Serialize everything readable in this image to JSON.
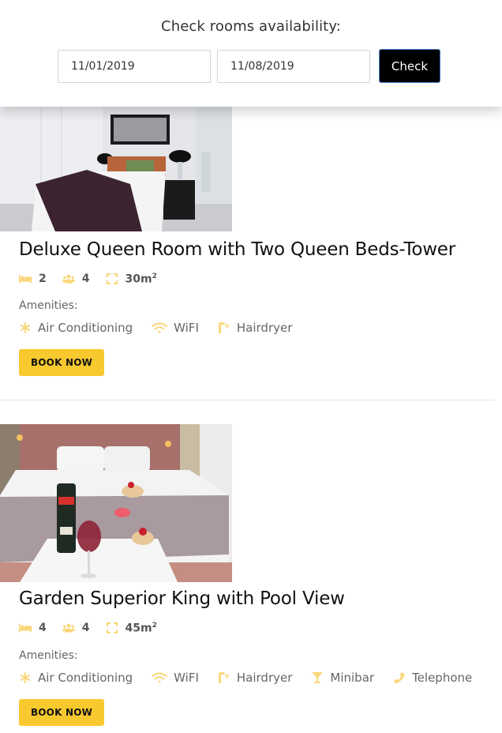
{
  "header": {
    "title": "Check rooms availability:",
    "check_in_value": "11/01/2019",
    "check_out_value": "11/08/2019",
    "check_button_label": "Check"
  },
  "colors": {
    "accent": "#f8c92e",
    "icon": "#f9d77a",
    "check_button_bg": "#000000"
  },
  "rooms": [
    {
      "image": "bedroom-white-interior-photo",
      "title": "Deluxe Queen Room with Two Queen Beds-Tower",
      "beds": "2",
      "guests": "4",
      "size": "30m",
      "size_unit_sup": "2",
      "amenities_label": "Amenities:",
      "amenities": [
        {
          "icon": "snowflake-icon",
          "label": "Air Conditioning"
        },
        {
          "icon": "wifi-icon",
          "label": "WiFI"
        },
        {
          "icon": "hairdryer-icon",
          "label": "Hairdryer"
        }
      ],
      "book_label": "BOOK NOW"
    },
    {
      "image": "bedroom-champagne-dessert-photo",
      "title": "Garden Superior King with Pool View",
      "beds": "4",
      "guests": "4",
      "size": "45m",
      "size_unit_sup": "2",
      "amenities_label": "Amenities:",
      "amenities": [
        {
          "icon": "snowflake-icon",
          "label": "Air Conditioning"
        },
        {
          "icon": "wifi-icon",
          "label": "WiFI"
        },
        {
          "icon": "hairdryer-icon",
          "label": "Hairdryer"
        },
        {
          "icon": "cocktail-icon",
          "label": "Minibar"
        },
        {
          "icon": "phone-icon",
          "label": "Telephone"
        }
      ],
      "book_label": "BOOK NOW"
    }
  ]
}
